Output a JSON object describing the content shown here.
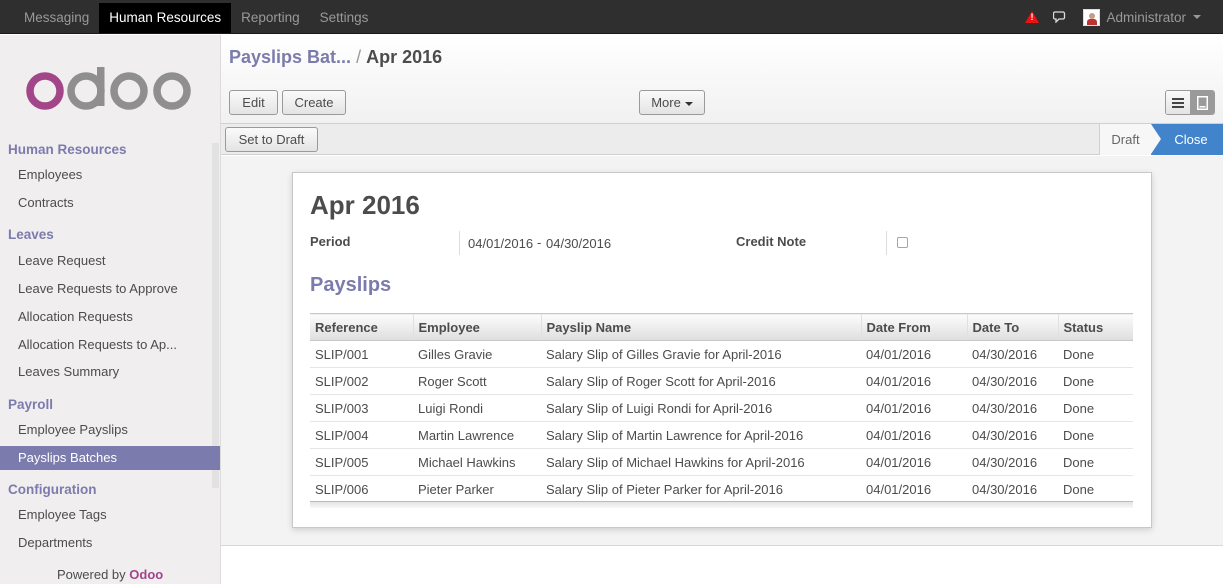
{
  "topbar": {
    "menu": [
      "Messaging",
      "Human Resources",
      "Reporting",
      "Settings"
    ],
    "active_menu": "Human Resources",
    "user": "Administrator",
    "icons": [
      "warning-icon",
      "chat-icon",
      "avatar"
    ]
  },
  "sidebar": {
    "logo_text": "odoo",
    "sections": [
      {
        "title": "Human Resources",
        "items": [
          "Employees",
          "Contracts"
        ]
      },
      {
        "title": "Leaves",
        "items": [
          "Leave Request",
          "Leave Requests to Approve",
          "Allocation Requests",
          "Allocation Requests to Ap...",
          "Leaves Summary"
        ]
      },
      {
        "title": "Payroll",
        "items": [
          "Employee Payslips",
          "Payslips Batches"
        ]
      },
      {
        "title": "Configuration",
        "items": [
          "Employee Tags",
          "Departments"
        ]
      }
    ],
    "active_item": "Payslips Batches",
    "powered_by": "Powered by",
    "powered_brand": "Odoo"
  },
  "breadcrumb": {
    "parent": "Payslips Bat...",
    "separator": "/",
    "current": "Apr 2016"
  },
  "buttons": {
    "edit": "Edit",
    "create": "Create",
    "more": "More",
    "set_to_draft": "Set to Draft"
  },
  "statusbar": {
    "states": [
      "Draft",
      "Close"
    ],
    "active_state": "Close"
  },
  "record": {
    "title": "Apr 2016",
    "period_label": "Period",
    "date_start": "04/01/2016",
    "date_sep": "-",
    "date_end": "04/30/2016",
    "credit_note_label": "Credit Note",
    "credit_note_checked": false,
    "payslips_title": "Payslips"
  },
  "table": {
    "columns": [
      "Reference",
      "Employee",
      "Payslip Name",
      "Date From",
      "Date To",
      "Status"
    ],
    "rows": [
      [
        "SLIP/001",
        "Gilles Gravie",
        "Salary Slip of Gilles Gravie for April-2016",
        "04/01/2016",
        "04/30/2016",
        "Done"
      ],
      [
        "SLIP/002",
        "Roger Scott",
        "Salary Slip of Roger Scott for April-2016",
        "04/01/2016",
        "04/30/2016",
        "Done"
      ],
      [
        "SLIP/003",
        "Luigi Rondi",
        "Salary Slip of Luigi Rondi for April-2016",
        "04/01/2016",
        "04/30/2016",
        "Done"
      ],
      [
        "SLIP/004",
        "Martin Lawrence",
        "Salary Slip of Martin Lawrence for April-2016",
        "04/01/2016",
        "04/30/2016",
        "Done"
      ],
      [
        "SLIP/005",
        "Michael Hawkins",
        "Salary Slip of Michael Hawkins for April-2016",
        "04/01/2016",
        "04/30/2016",
        "Done"
      ],
      [
        "SLIP/006",
        "Pieter Parker",
        "Salary Slip of Pieter Parker for April-2016",
        "04/01/2016",
        "04/30/2016",
        "Done"
      ]
    ]
  },
  "colors": {
    "brand_purple": "#7c7bad",
    "status_blue": "#4284cc",
    "topbar": "#2f2f2f",
    "odoo_magenta": "#a24689"
  }
}
